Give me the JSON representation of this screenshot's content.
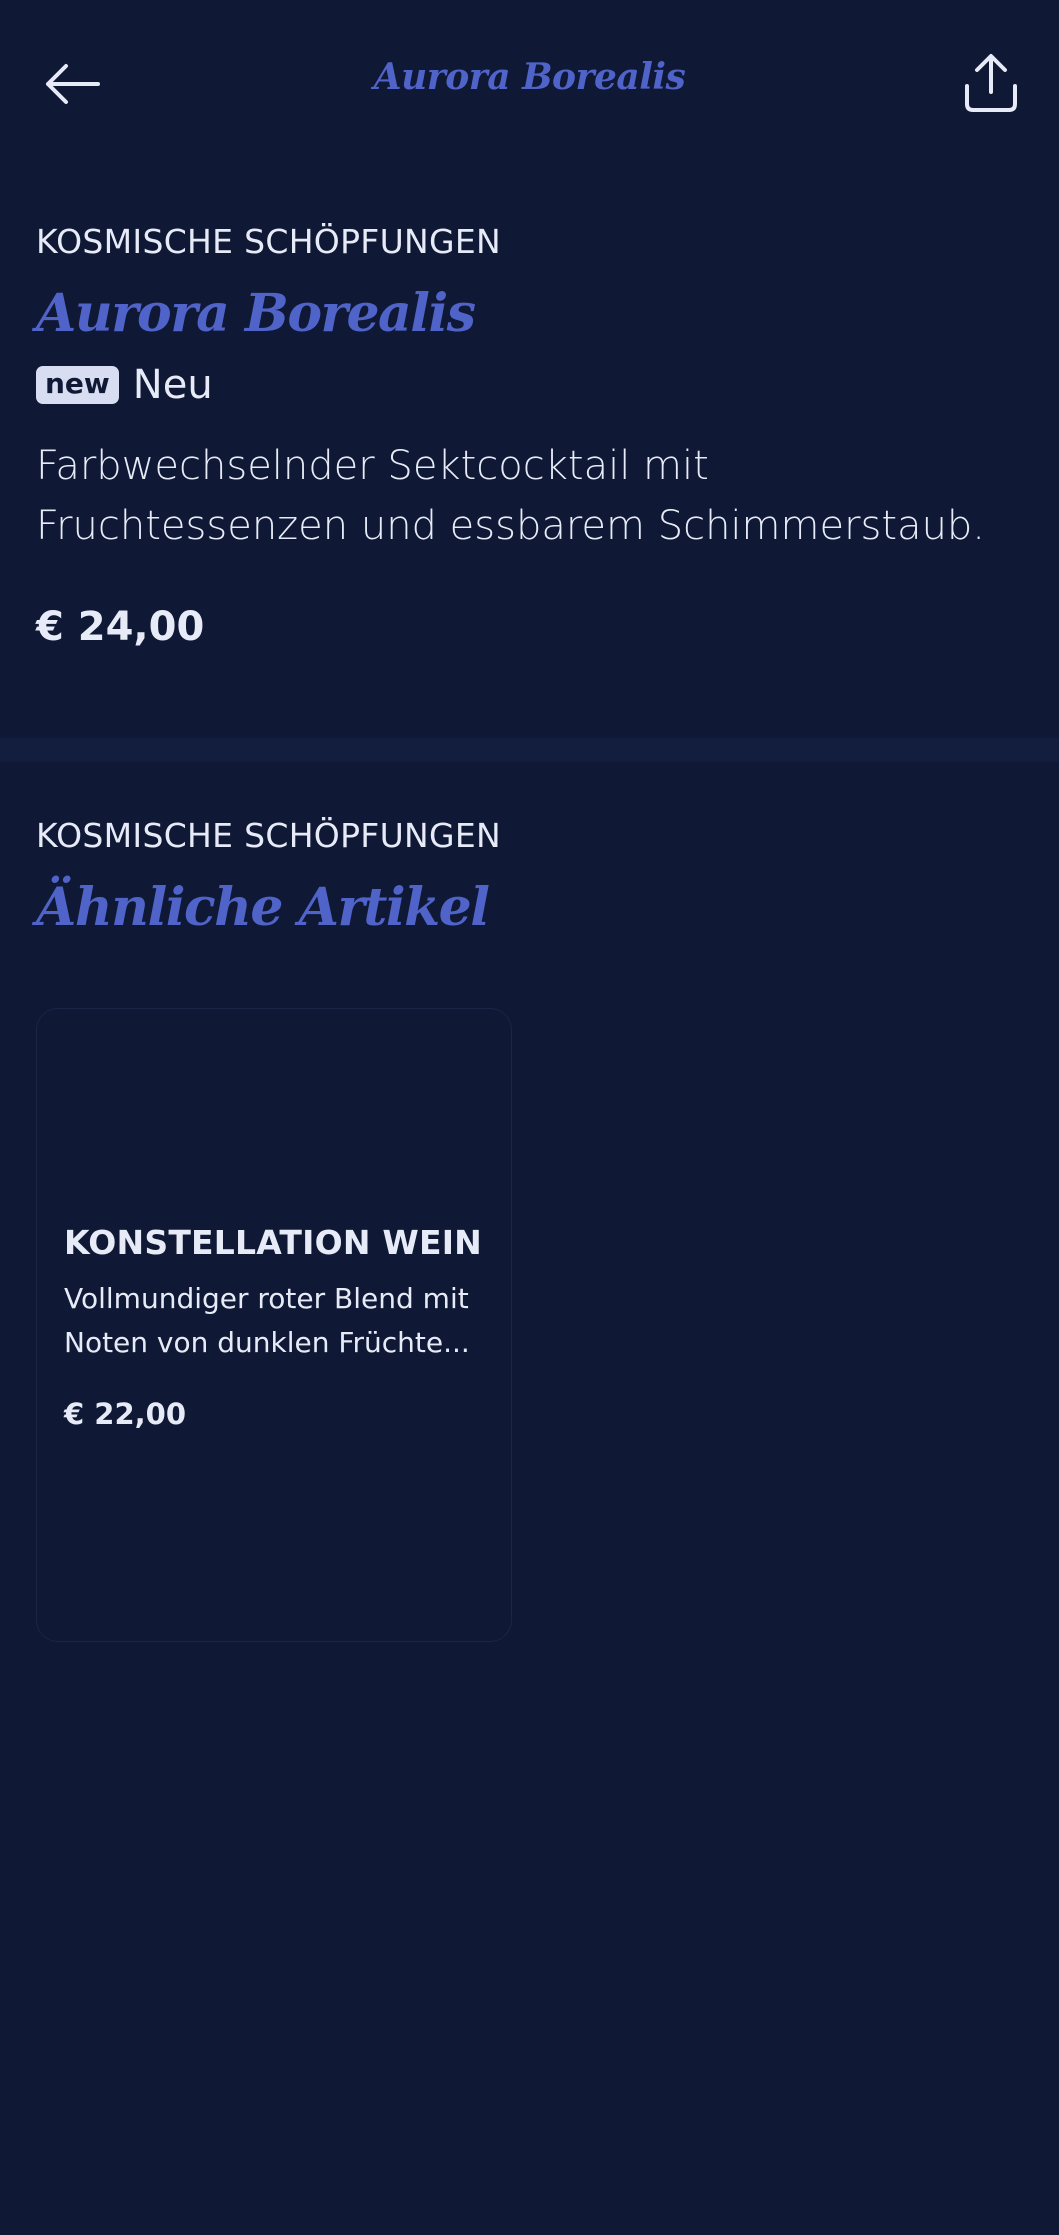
{
  "header": {
    "title": "Aurora Borealis"
  },
  "product": {
    "category": "KOSMISCHE SCHÖPFUNGEN",
    "name": "Aurora Borealis",
    "badge": "new",
    "badge_label": "Neu",
    "description": "Farbwechselnder Sektcocktail mit Fruchtessenzen und essbarem Schimmerstaub.",
    "price": "€ 24,00"
  },
  "similar": {
    "category": "KOSMISCHE SCHÖPFUNGEN",
    "title": "Ähnliche Artikel",
    "items": [
      {
        "name": "KONSTELLATION WEIN",
        "description": "Vollmundiger roter Blend mit Noten von dunklen Früchte...",
        "price": "€ 22,00"
      }
    ]
  },
  "colors": {
    "background": "#0f1834",
    "accent": "#4f63c9",
    "text": "#e7ebf7",
    "badge_bg": "#d9ddf1"
  },
  "icons": {
    "back": "arrow-left-icon",
    "share": "share-icon"
  }
}
